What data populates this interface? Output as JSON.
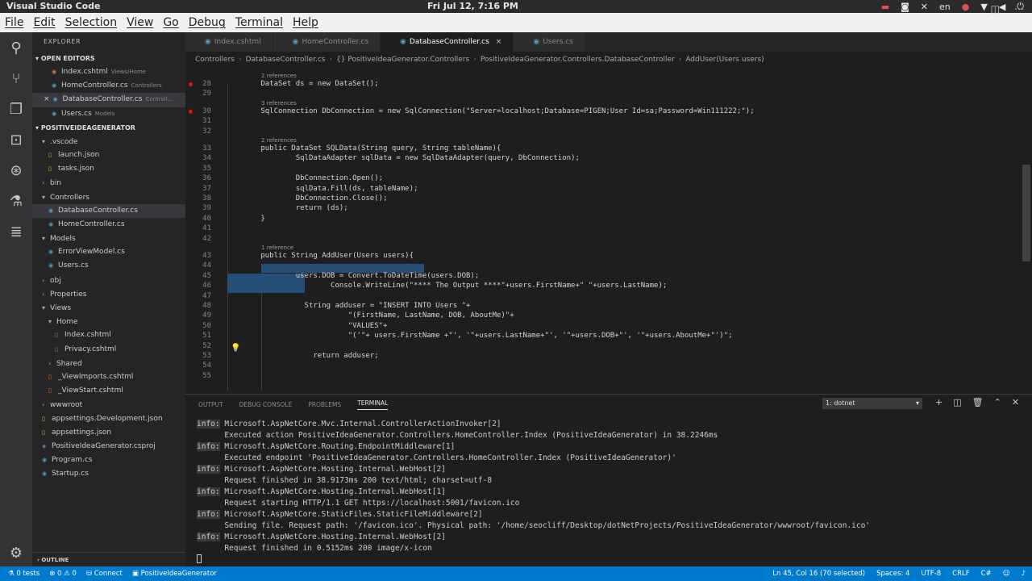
{
  "system_bar": {
    "app_name": "Visual Studio Code",
    "clock": "Fri Jul 12,  7:16 PM",
    "lang": "en"
  },
  "menu": [
    "File",
    "Edit",
    "Selection",
    "View",
    "Go",
    "Debug",
    "Terminal",
    "Help"
  ],
  "activity_icons": [
    "files-icon",
    "search-icon",
    "source-control-icon",
    "debug-icon",
    "extensions-icon",
    "test-icon",
    "database-icon"
  ],
  "sidebar": {
    "title": "EXPLORER",
    "open_editors_label": "OPEN EDITORS",
    "open_editors": [
      {
        "name": "Index.cshtml",
        "desc": "Views/Home",
        "kind": "html"
      },
      {
        "name": "HomeController.cs",
        "desc": "Controllers",
        "kind": "cs"
      },
      {
        "name": "DatabaseController.cs",
        "desc": "Controll...",
        "kind": "cs",
        "close": "×"
      },
      {
        "name": "Users.cs",
        "desc": "Models",
        "kind": "cs"
      }
    ],
    "project_label": "POSITIVEIDEAGENERATOR",
    "tree": [
      {
        "name": ".vscode",
        "depth": 1,
        "folder": true,
        "open": true
      },
      {
        "name": "launch.json",
        "depth": 2,
        "kind": "json"
      },
      {
        "name": "tasks.json",
        "depth": 2,
        "kind": "json"
      },
      {
        "name": "bin",
        "depth": 1,
        "folder": true,
        "open": false
      },
      {
        "name": "Controllers",
        "depth": 1,
        "folder": true,
        "open": true
      },
      {
        "name": "DatabaseController.cs",
        "depth": 2,
        "kind": "cs",
        "active": true
      },
      {
        "name": "HomeController.cs",
        "depth": 2,
        "kind": "cs"
      },
      {
        "name": "Models",
        "depth": 1,
        "folder": true,
        "open": true
      },
      {
        "name": "ErrorViewModel.cs",
        "depth": 2,
        "kind": "cs"
      },
      {
        "name": "Users.cs",
        "depth": 2,
        "kind": "cs"
      },
      {
        "name": "obj",
        "depth": 1,
        "folder": true,
        "open": false
      },
      {
        "name": "Properties",
        "depth": 1,
        "folder": true,
        "open": false
      },
      {
        "name": "Views",
        "depth": 1,
        "folder": true,
        "open": true
      },
      {
        "name": "Home",
        "depth": 2,
        "folder": true,
        "open": true
      },
      {
        "name": "Index.cshtml",
        "depth": 3,
        "kind": "html"
      },
      {
        "name": "Privacy.cshtml",
        "depth": 3,
        "kind": "html"
      },
      {
        "name": "Shared",
        "depth": 2,
        "folder": true,
        "open": false
      },
      {
        "name": "_ViewImports.cshtml",
        "depth": 2,
        "kind": "html"
      },
      {
        "name": "_ViewStart.cshtml",
        "depth": 2,
        "kind": "html"
      },
      {
        "name": "wwwroot",
        "depth": 1,
        "folder": true,
        "open": false
      },
      {
        "name": "appsettings.Development.json",
        "depth": 1,
        "kind": "json"
      },
      {
        "name": "appsettings.json",
        "depth": 1,
        "kind": "json"
      },
      {
        "name": "PositiveIdeaGenerator.csproj",
        "depth": 1,
        "kind": "proj"
      },
      {
        "name": "Program.cs",
        "depth": 1,
        "kind": "cs"
      },
      {
        "name": "Startup.cs",
        "depth": 1,
        "kind": "cs"
      }
    ],
    "outline_label": "OUTLINE"
  },
  "tabs": [
    {
      "label": "Index.cshtml",
      "active": false
    },
    {
      "label": "HomeController.cs",
      "active": false
    },
    {
      "label": "DatabaseController.cs",
      "active": true
    },
    {
      "label": "Users.cs",
      "active": false
    }
  ],
  "breadcrumb": [
    "Controllers",
    "DatabaseController.cs",
    "{} PositiveIdeaGenerator.Controllers",
    "PositiveIdeaGenerator.Controllers.DatabaseController",
    "AddUser(Users users)"
  ],
  "editor": {
    "lines": [
      {
        "n": "28",
        "lens": "2 references",
        "text": "        DataSet ds = new DataSet();",
        "bp": true
      },
      {
        "n": "29",
        "text": ""
      },
      {
        "n": "30",
        "lens": "3 references",
        "text": "        SqlConnection DbConnection = new SqlConnection(\"Server=localhost;Database=PIGEN;User Id=sa;Password=Win111222;\");",
        "bp": true
      },
      {
        "n": "31",
        "text": ""
      },
      {
        "n": "32",
        "text": ""
      },
      {
        "n": "33",
        "lens": "2 references",
        "text": "        public DataSet SQLData(String query, String tableName){"
      },
      {
        "n": "34",
        "text": "                SqlDataAdapter sqlData = new SqlDataAdapter(query, DbConnection);"
      },
      {
        "n": "35",
        "text": ""
      },
      {
        "n": "36",
        "text": "                DbConnection.Open();"
      },
      {
        "n": "37",
        "text": "                sqlData.Fill(ds, tableName);"
      },
      {
        "n": "38",
        "text": "                DbConnection.Close();"
      },
      {
        "n": "39",
        "text": "                return (ds);"
      },
      {
        "n": "40",
        "text": "        }"
      },
      {
        "n": "41",
        "text": ""
      },
      {
        "n": "42",
        "text": ""
      },
      {
        "n": "43",
        "lens": "1 reference",
        "text": "        public String AddUser(Users users){"
      },
      {
        "n": "44",
        "text": ""
      },
      {
        "n": "45",
        "text": "                users.DOB = Convert.ToDateTime(users.DOB);"
      },
      {
        "n": "46",
        "text": "                        Console.WriteLine(\"**** The Output ****\"+users.FirstName+\" \"+users.LastName);"
      },
      {
        "n": "47",
        "text": ""
      },
      {
        "n": "48",
        "text": "                  String adduser = \"INSERT INTO Users \"+"
      },
      {
        "n": "49",
        "text": "                            \"(FirstName, LastName, DOB, AboutMe)\"+"
      },
      {
        "n": "50",
        "text": "                            \"VALUES\"+"
      },
      {
        "n": "51",
        "text": "                            \"('\"+ users.FirstName +\"', '\"+users.LastName+\"', '\"+users.DOB+\"', '\"+users.AboutMe+\"')\";"
      },
      {
        "n": "52",
        "text": ""
      },
      {
        "n": "53",
        "text": "                    return adduser;"
      },
      {
        "n": "54",
        "text": ""
      },
      {
        "n": "55",
        "text": ""
      }
    ]
  },
  "panel": {
    "tabs": [
      "OUTPUT",
      "DEBUG CONSOLE",
      "PROBLEMS",
      "TERMINAL"
    ],
    "active_tab": "TERMINAL",
    "terminal_select": "1: dotnet",
    "lines": [
      {
        "info": true,
        "text": "Microsoft.AspNetCore.Mvc.Internal.ControllerActionInvoker[2]"
      },
      {
        "info": false,
        "text": "      Executed action PositiveIdeaGenerator.Controllers.HomeController.Index (PositiveIdeaGenerator) in 38.2246ms"
      },
      {
        "info": true,
        "text": "Microsoft.AspNetCore.Routing.EndpointMiddleware[1]"
      },
      {
        "info": false,
        "text": "      Executed endpoint 'PositiveIdeaGenerator.Controllers.HomeController.Index (PositiveIdeaGenerator)'"
      },
      {
        "info": true,
        "text": "Microsoft.AspNetCore.Hosting.Internal.WebHost[2]"
      },
      {
        "info": false,
        "text": "      Request finished in 38.9173ms 200 text/html; charset=utf-8"
      },
      {
        "info": true,
        "text": "Microsoft.AspNetCore.Hosting.Internal.WebHost[1]"
      },
      {
        "info": false,
        "text": "      Request starting HTTP/1.1 GET https://localhost:5001/favicon.ico"
      },
      {
        "info": true,
        "text": "Microsoft.AspNetCore.StaticFiles.StaticFileMiddleware[2]"
      },
      {
        "info": false,
        "text": "      Sending file. Request path: '/favicon.ico'. Physical path: '/home/seocliff/Desktop/dotNetProjects/PositiveIdeaGenerator/wwwroot/favicon.ico'"
      },
      {
        "info": true,
        "text": "Microsoft.AspNetCore.Hosting.Internal.WebHost[2]"
      },
      {
        "info": false,
        "text": "      Request finished in 0.5152ms 200 image/x-icon"
      }
    ],
    "info_prefix": "info:"
  },
  "status": {
    "tests": "0 tests",
    "errors": "0",
    "warnings": "0",
    "connect": "Connect",
    "project": "PositiveIdeaGenerator",
    "position": "Ln 45, Col 16 (70 selected)",
    "spaces": "Spaces: 4",
    "encoding": "UTF-8",
    "eol": "CRLF",
    "lang": "C#"
  }
}
